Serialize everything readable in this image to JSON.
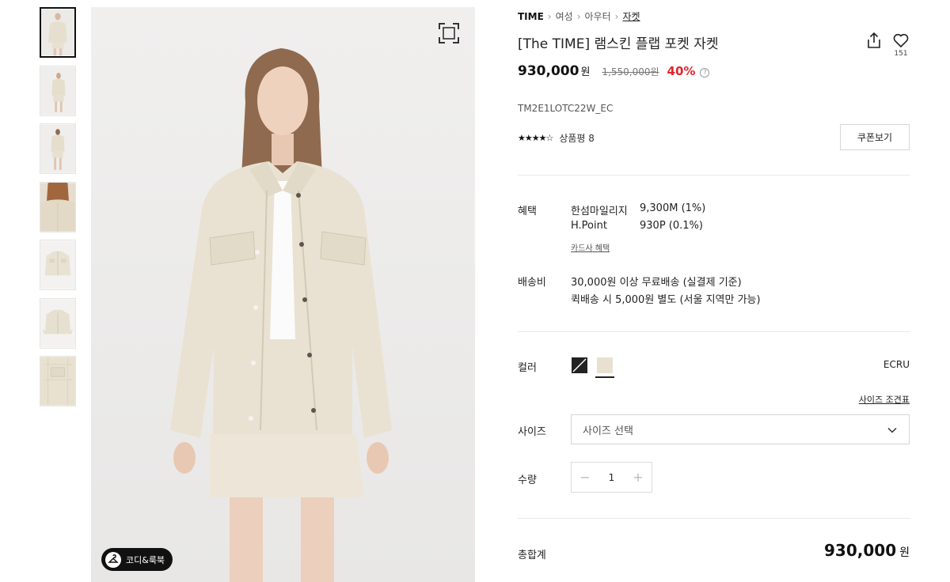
{
  "breadcrumb": {
    "brand": "TIME",
    "items": [
      "여성",
      "아우터",
      "자켓"
    ]
  },
  "product": {
    "title": "[The TIME] 램스킨 플랩 포켓 자켓",
    "like_count": "151",
    "price": "930,000",
    "currency": "원",
    "original_price": "1,550,000원",
    "discount": "40%",
    "code": "TM2E1LOTC22W_EC",
    "rating": 4.5,
    "review_label": "상품평 8",
    "coupon_label": "쿠폰보기"
  },
  "benefits": {
    "label": "혜택",
    "rows": [
      {
        "name": "한섬마일리지",
        "value": "9,300M (1%)"
      },
      {
        "name": "H.Point",
        "value": "930P (0.1%)"
      }
    ],
    "card_link": "카드사 혜택"
  },
  "shipping": {
    "label": "배송비",
    "line1": "30,000원 이상 무료배송 (실결제 기준)",
    "line2": "퀵배송 시 5,000원 별도 (서울 지역만 가능)"
  },
  "color": {
    "label": "컬러",
    "selected": "ECRU",
    "swatches": [
      {
        "name": "BLACK",
        "hex": "#222222"
      },
      {
        "name": "ECRU",
        "hex": "#e8e1d2"
      }
    ]
  },
  "size": {
    "guide_link": "사이즈 조견표",
    "label": "사이즈",
    "placeholder": "사이즈 선택"
  },
  "quantity": {
    "label": "수량",
    "value": "1"
  },
  "total": {
    "label": "총합계",
    "price": "930,000",
    "currency": "원"
  },
  "gallery": {
    "lookbook_label": "코디&룩북",
    "thumb_count": 7
  }
}
